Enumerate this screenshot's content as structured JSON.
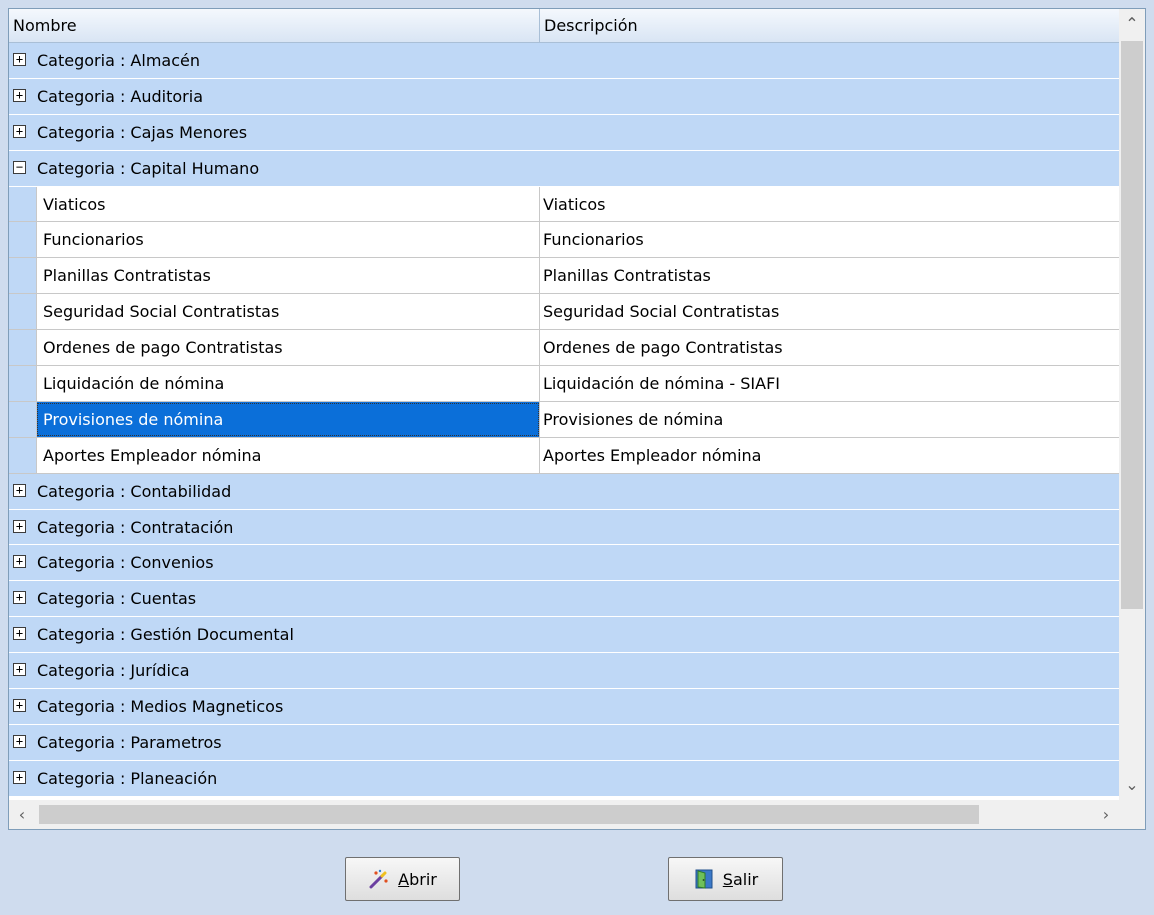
{
  "columns": {
    "name": "Nombre",
    "description": "Descripción"
  },
  "categories_before": [
    {
      "label": "Categoria : Almacén",
      "toggle": "+"
    },
    {
      "label": "Categoria : Auditoria",
      "toggle": "+"
    },
    {
      "label": "Categoria : Cajas Menores",
      "toggle": "+"
    }
  ],
  "expanded_category": {
    "label": "Categoria : Capital Humano",
    "toggle": "−"
  },
  "items": [
    {
      "name": "Viaticos",
      "description": "Viaticos"
    },
    {
      "name": "Funcionarios",
      "description": "Funcionarios"
    },
    {
      "name": "Planillas Contratistas",
      "description": "Planillas Contratistas"
    },
    {
      "name": "Seguridad Social Contratistas",
      "description": "Seguridad Social Contratistas"
    },
    {
      "name": "Ordenes de pago Contratistas",
      "description": "Ordenes de pago Contratistas"
    },
    {
      "name": "Liquidación de nómina",
      "description": "Liquidación de nómina - SIAFI"
    },
    {
      "name": "Provisiones de nómina",
      "description": "Provisiones de nómina",
      "selected": true
    },
    {
      "name": "Aportes Empleador nómina",
      "description": "Aportes Empleador nómina"
    }
  ],
  "categories_after": [
    {
      "label": "Categoria : Contabilidad",
      "toggle": "+"
    },
    {
      "label": "Categoria : Contratación",
      "toggle": "+"
    },
    {
      "label": "Categoria : Convenios",
      "toggle": "+"
    },
    {
      "label": "Categoria : Cuentas",
      "toggle": "+"
    },
    {
      "label": "Categoria : Gestión Documental",
      "toggle": "+"
    },
    {
      "label": "Categoria : Jurídica",
      "toggle": "+"
    },
    {
      "label": "Categoria : Medios Magneticos",
      "toggle": "+"
    },
    {
      "label": "Categoria : Parametros",
      "toggle": "+"
    },
    {
      "label": "Categoria : Planeación",
      "toggle": "+"
    }
  ],
  "buttons": {
    "open": {
      "mnemonic": "A",
      "rest": "brir",
      "icon": "magic-wand-icon"
    },
    "exit": {
      "mnemonic": "S",
      "rest": "alir",
      "icon": "door-exit-icon"
    }
  },
  "scroll_arrows": {
    "up": "⌃",
    "down": "⌄",
    "left": "‹",
    "right": "›"
  },
  "colors": {
    "group_row": "#bfd8f6",
    "selection": "#0b6fd9",
    "background": "#cfdcee"
  }
}
